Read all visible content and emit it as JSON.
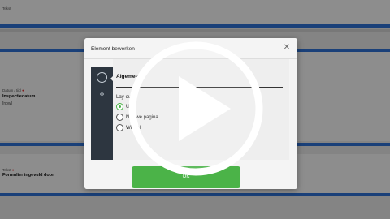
{
  "background": {
    "field1": {
      "label": "Tekst"
    },
    "field2": {
      "label": "Datum / tijd",
      "value": "Inspectiedatum",
      "sub": "[now]"
    },
    "field3": {
      "label": "Tekst",
      "value": "Formulier ingevuld door"
    }
  },
  "dialog": {
    "title": "Element bewerken",
    "close_icon": "close-icon",
    "sidebar": [
      {
        "icon": "info-icon",
        "glyph": "i"
      },
      {
        "icon": "link-icon",
        "glyph": "⚭"
      }
    ],
    "section_title": "Algemeen",
    "layout_label": "Lay-out",
    "layout_options": [
      {
        "label": "U",
        "checked": true
      },
      {
        "label": "Nieuwe pagina",
        "checked": false
      },
      {
        "label": "Wit vel",
        "checked": false
      }
    ],
    "ok_label": "OK"
  },
  "overlay": {
    "icon": "play-icon"
  },
  "colors": {
    "accent": "#4bb348",
    "bar": "#2d6fd1",
    "sidebar": "#2d3640"
  }
}
